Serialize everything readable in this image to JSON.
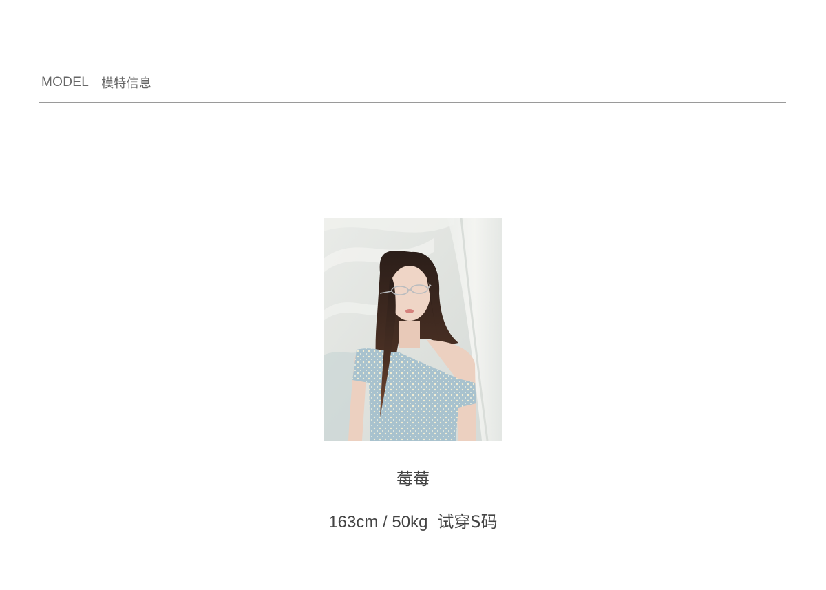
{
  "section": {
    "title_en": "MODEL",
    "title_zh": "模特信息"
  },
  "model": {
    "photo_alt": "model-photo",
    "name": "莓莓",
    "separator": "—",
    "measurements": "163cm / 50kg",
    "size_tried": "试穿S码"
  },
  "colors": {
    "rule": "#9a9a9a",
    "text": "#444444",
    "backdrop": "#e4e7e4",
    "top_fabric": "#a9c3cf",
    "hair": "#3a2a22"
  }
}
